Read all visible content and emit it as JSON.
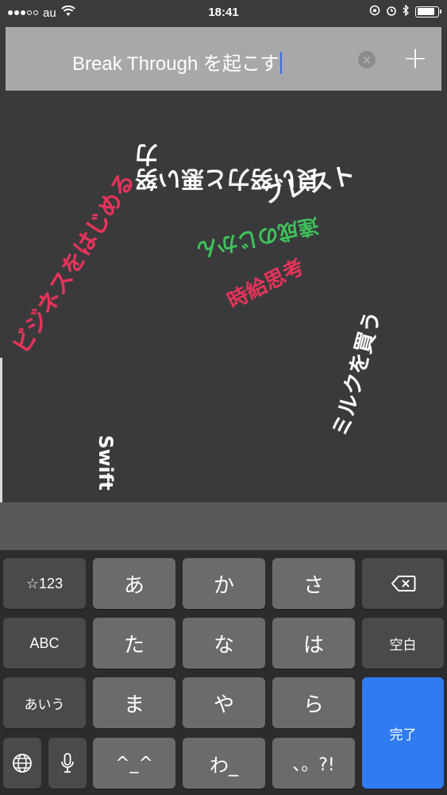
{
  "status_bar": {
    "carrier": "au",
    "time": "18:41",
    "battery_level": 0.85
  },
  "input": {
    "value": "Break Through を起こす",
    "clear_icon": "clear-icon",
    "add_label": "+"
  },
  "canvas_words": [
    {
      "text": "ブレスト",
      "color": "#ffffff"
    },
    {
      "text": "良い努力と悪い努力",
      "color": "#ffffff"
    },
    {
      "text": "ビジネスをはじめる",
      "color": "#e8335a"
    },
    {
      "text": "達成のじかん",
      "color": "#3ec25a"
    },
    {
      "text": "時給思考",
      "color": "#e8335a"
    },
    {
      "text": "ミルクを買う",
      "color": "#ffffff"
    },
    {
      "text": "Swift",
      "color": "#ffffff"
    }
  ],
  "keyboard": {
    "row1": [
      "☆123",
      "あ",
      "か",
      "さ"
    ],
    "row2": [
      "ABC",
      "た",
      "な",
      "は",
      "空白"
    ],
    "row3": [
      "あいう",
      "ま",
      "や",
      "ら"
    ],
    "row4": [
      "^_^",
      "わ_",
      "、。?!"
    ],
    "done_label": "完了",
    "icons": {
      "backspace": "backspace-icon",
      "globe": "globe-icon",
      "mic": "microphone-icon"
    }
  }
}
